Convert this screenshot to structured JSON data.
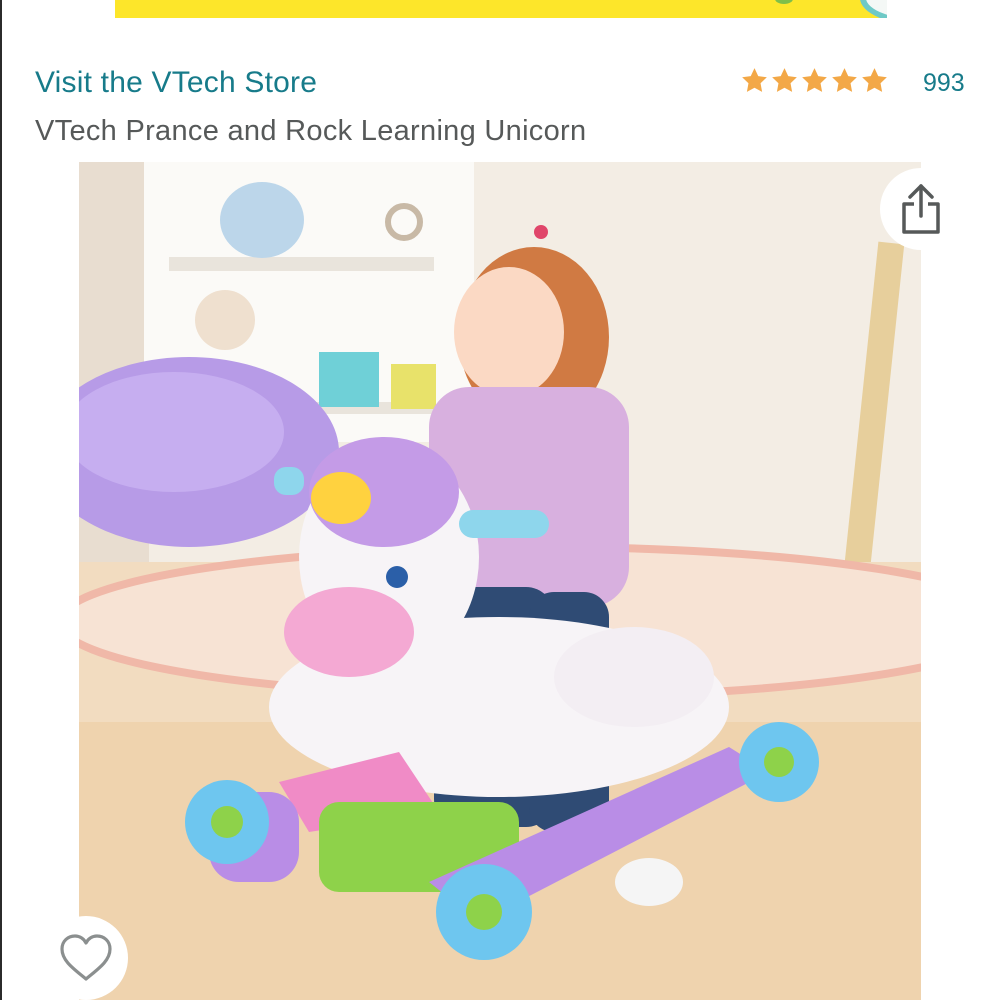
{
  "store": {
    "link_label": "Visit the VTech Store"
  },
  "product": {
    "title": "VTech Prance and Rock Learning Unicorn"
  },
  "rating": {
    "stars": 5,
    "count": "993",
    "star_color": "#f3a847"
  },
  "colors": {
    "link": "#177b8a",
    "title": "#565959",
    "banner": "#fde62a"
  },
  "image": {
    "subject": "child-on-unicorn-rocker-photo"
  },
  "actions": {
    "share_icon": "share-icon",
    "wishlist_icon": "heart-icon"
  }
}
